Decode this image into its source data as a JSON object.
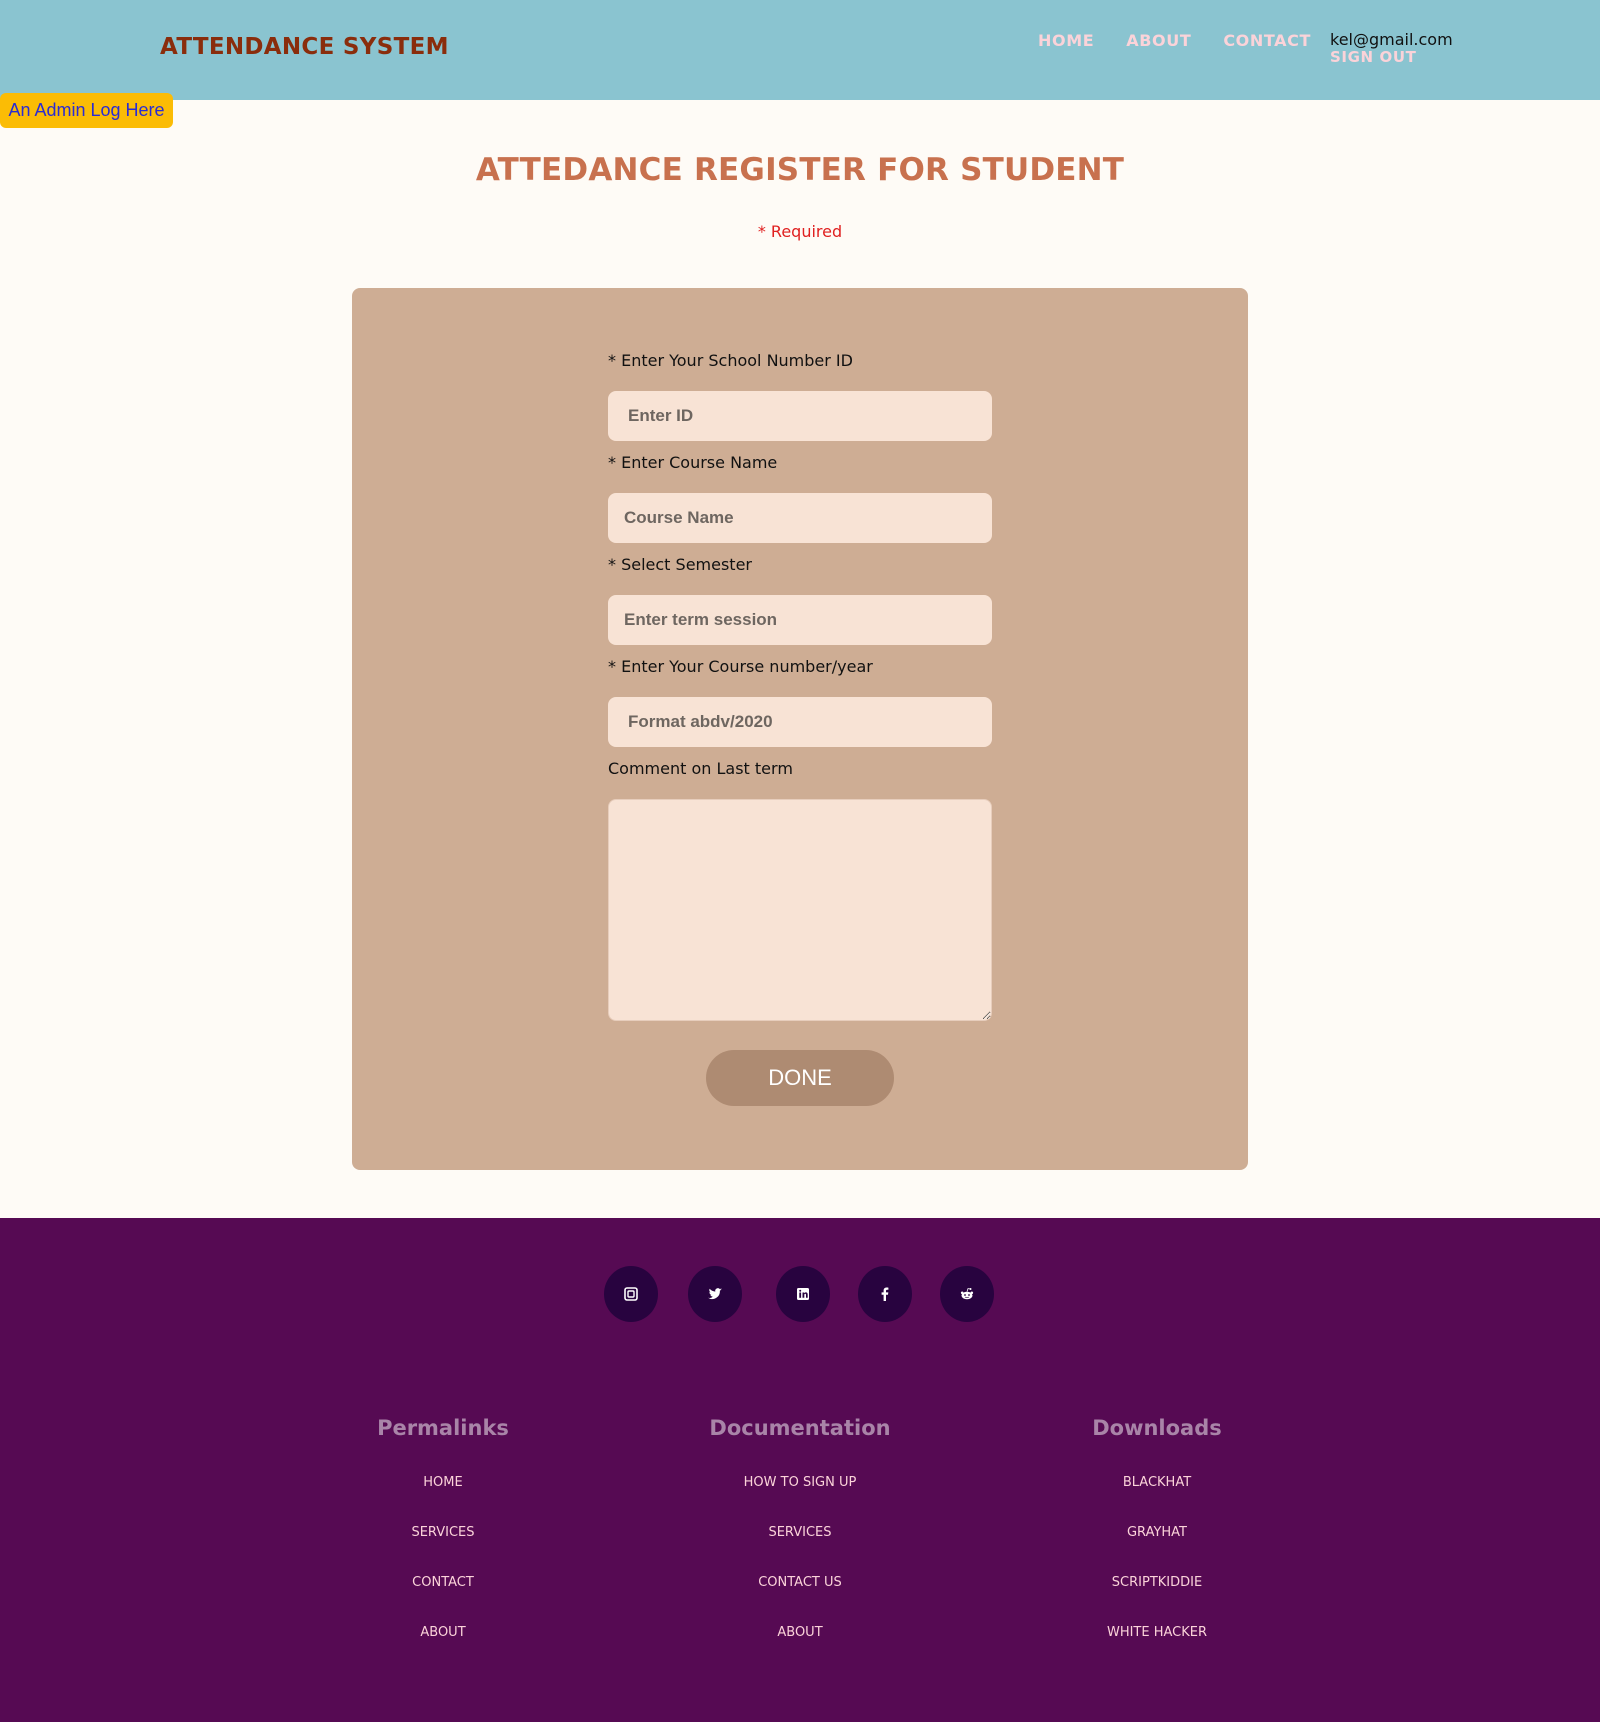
{
  "header": {
    "brand": "ATTENDANCE SYSTEM",
    "nav": [
      "HOME",
      "ABOUT",
      "CONTACT"
    ],
    "user_email": "kel@gmail.com",
    "sign_out": "SIGN OUT"
  },
  "admin_link": "An Admin Log Here",
  "main": {
    "title": "ATTEDANCE REGISTER FOR STUDENT",
    "required_note": "* Required"
  },
  "form": {
    "school_id": {
      "label": "* Enter Your School Number ID",
      "placeholder": "Enter ID"
    },
    "course_name": {
      "label": "* Enter Course Name",
      "placeholder": "Course Name"
    },
    "semester": {
      "label": "* Select Semester",
      "placeholder": "Enter term session"
    },
    "course_number": {
      "label": "* Enter Your Course number/year",
      "placeholder": "Format abdv/2020"
    },
    "comment": {
      "label": "Comment on Last term",
      "value": ""
    },
    "submit_label": "DONE"
  },
  "footer": {
    "social": [
      "instagram-icon",
      "twitter-icon",
      "linkedin-icon",
      "facebook-icon",
      "reddit-icon"
    ],
    "columns": [
      {
        "title": "Permalinks",
        "links": [
          "HOME",
          "SERVICES",
          "CONTACT",
          "ABOUT"
        ]
      },
      {
        "title": "Documentation",
        "links": [
          "HOW TO SIGN UP",
          "SERVICES",
          "CONTACT US",
          "ABOUT"
        ]
      },
      {
        "title": "Downloads",
        "links": [
          "BLACKHAT",
          "GRAYHAT",
          "SCRIPTKIDDIE",
          "WHITE HACKER"
        ]
      }
    ]
  },
  "colors": {
    "header_bg": "#8ac4d0",
    "brand": "#8a2d0c",
    "nav_link": "#fbd3d9",
    "admin_button": "#fbbc05",
    "title": "#c8714e",
    "card_bg": "#cead94",
    "input_bg": "#f8e3d5",
    "done_button": "#ae8b72",
    "footer_bg": "#560a53",
    "social_bg": "#28033f"
  }
}
